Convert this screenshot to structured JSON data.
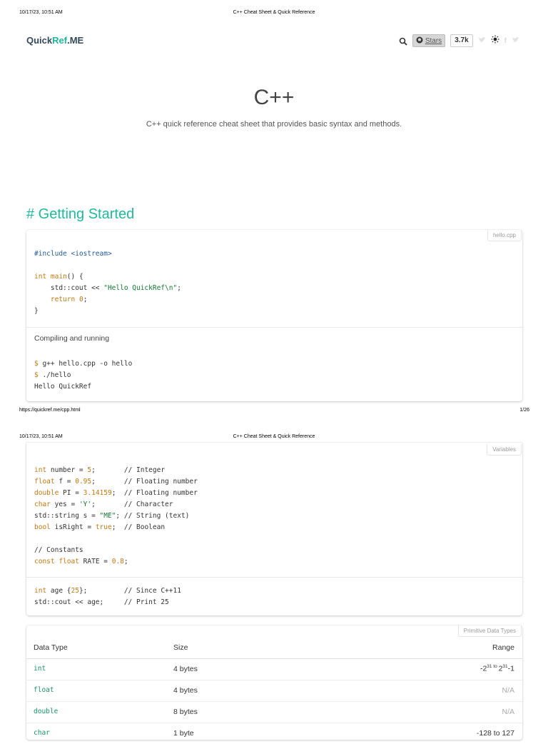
{
  "print": {
    "page1": {
      "datetime": "10/17/23, 10:51 AM",
      "doc_title": "C++ Cheat Sheet & Quick Reference",
      "url": "https://quickref.me/cpp.html",
      "page_num": "1/26"
    },
    "page2": {
      "datetime": "10/17/23, 10:51 AM",
      "doc_title": "C++ Cheat Sheet & Quick Reference"
    }
  },
  "header": {
    "logo_quick": "Quick",
    "logo_ref": "Ref",
    "logo_me": ".ME",
    "stars_label": "Stars",
    "stars_count": "3.7k"
  },
  "hero": {
    "title": "C++",
    "description": "C++ quick reference cheat sheet that provides basic syntax and methods."
  },
  "section": {
    "title": "# Getting Started"
  },
  "hello_card": {
    "tag": "hello.cpp",
    "compile_note": "Compiling and running"
  },
  "variables_card": {
    "tag": "Variables"
  },
  "types_table": {
    "tag": "Primitive Data Types",
    "headers": [
      "Data Type",
      "Size",
      "Range"
    ],
    "rows": [
      {
        "type": "int",
        "size": "4 bytes",
        "range_base": "-2",
        "range_exp1": "31",
        "range_to": " to ",
        "range_base2": "2",
        "range_exp2": "31",
        "range_tail": "-1"
      },
      {
        "type": "float",
        "size": "4 bytes",
        "range": "N/A"
      },
      {
        "type": "double",
        "size": "8 bytes",
        "range": "N/A"
      },
      {
        "type": "char",
        "size": "1 byte",
        "range": "-128 to 127"
      }
    ]
  },
  "colors": {
    "accent": "#1abc9c",
    "keyword": "#c5780a",
    "string": "#0d7a2f"
  }
}
